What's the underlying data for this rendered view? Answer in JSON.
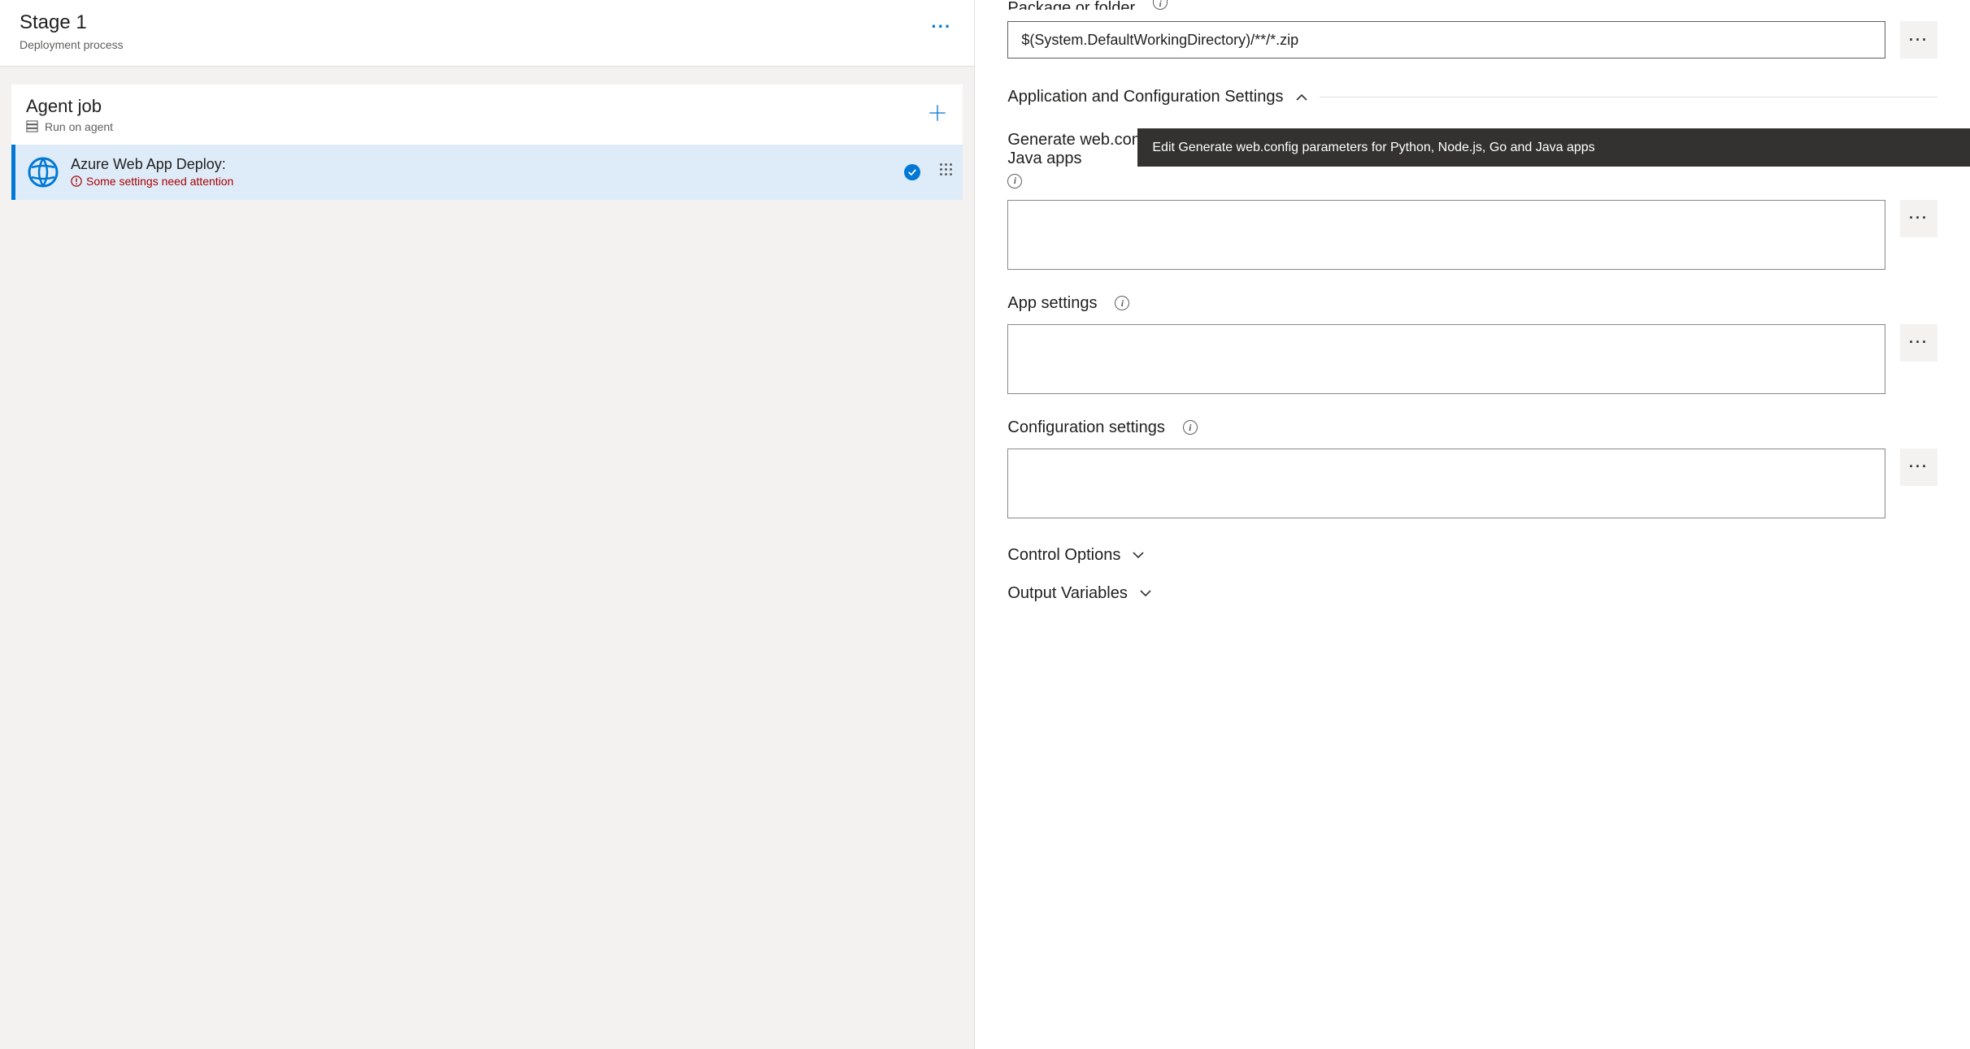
{
  "leftPanel": {
    "stage": {
      "title": "Stage 1",
      "subtitle": "Deployment process"
    },
    "agentJob": {
      "title": "Agent job",
      "subtitle": "Run on agent"
    },
    "task": {
      "title": "Azure Web App Deploy:",
      "warning": "Some settings need attention"
    }
  },
  "rightPanel": {
    "packageLabel": "Package or folder",
    "packageValue": "$(System.DefaultWorkingDirectory)/**/*.zip",
    "appConfigSection": "Application and Configuration Settings",
    "webconfigLabel": "Generate web.config parameters for Python, Node.js, Go and Java apps",
    "webconfigValue": "",
    "appSettingsLabel": "App settings",
    "appSettingsValue": "",
    "configSettingsLabel": "Configuration settings",
    "configSettingsValue": "",
    "controlOptions": "Control Options",
    "outputVars": "Output Variables",
    "tooltip": "Edit Generate web.config parameters for Python, Node.js, Go and Java apps"
  }
}
